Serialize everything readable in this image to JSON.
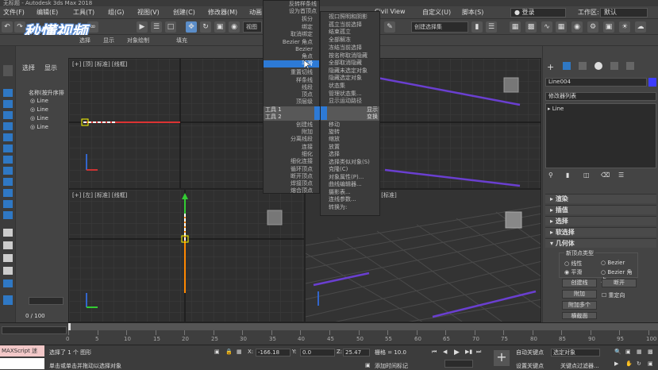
{
  "window": {
    "title": "无标题 - Autodesk 3ds Max 2018"
  },
  "menubar": {
    "items": [
      "文件(F)",
      "编辑(E)",
      "工具(T)",
      "组(G)",
      "视图(V)",
      "创建(C)",
      "修改器(M)",
      "动画",
      "Civil View",
      "自定义(U)",
      "脚本(S)"
    ],
    "login": "登录",
    "workspace_label": "工作区:",
    "workspace_value": "默认"
  },
  "toolbar": {
    "view_combo": "视图",
    "selection_set": "创建选择集"
  },
  "logo": {
    "text": "秒懂视频"
  },
  "ribbon": {
    "items": [
      "选择",
      "显示",
      "对象绘制",
      "填充"
    ]
  },
  "scene_explorer": {
    "tabs": [
      "选择",
      "显示"
    ],
    "header": "名称(按升序排",
    "items": [
      "Line",
      "Line",
      "Line",
      "Line"
    ]
  },
  "viewports": {
    "top": "[+] [顶] [标准] [线框]",
    "front": "[+] [前] [标准] [线框]",
    "left": "[+] [左] [标准] [线框]",
    "persp": "[+] [透视] [标准]"
  },
  "context_menu": {
    "quad1": [
      {
        "t": "反转样条线",
        "c": ""
      },
      {
        "t": "设为首顶点",
        "c": ""
      },
      {
        "t": "拆分",
        "c": ""
      },
      {
        "t": "绑定",
        "c": ""
      },
      {
        "t": "取消绑定",
        "c": ""
      },
      {
        "t": "Bezier 角点",
        "c": ""
      },
      {
        "t": "Bezier",
        "c": ""
      },
      {
        "t": "角点",
        "c": ""
      },
      {
        "t": "平滑",
        "c": "hl"
      },
      {
        "t": "重置切线",
        "c": ""
      },
      {
        "t": "样条线",
        "c": ""
      },
      {
        "t": "线段",
        "c": ""
      },
      {
        "t": "顶点",
        "c": ""
      },
      {
        "t": "顶层级",
        "c": ""
      }
    ],
    "tools1": "工具 1",
    "tools2": "工具 2",
    "quad1_lower": [
      {
        "t": "创建线",
        "c": ""
      },
      {
        "t": "附加",
        "c": ""
      },
      {
        "t": "分离线段",
        "c": ""
      },
      {
        "t": "连接",
        "c": ""
      },
      {
        "t": "细化",
        "c": ""
      },
      {
        "t": "细化连接",
        "c": ""
      },
      {
        "t": "循环顶点",
        "c": ""
      },
      {
        "t": "断开顶点",
        "c": ""
      },
      {
        "t": "焊接顶点",
        "c": ""
      },
      {
        "t": "熔合顶点",
        "c": ""
      }
    ],
    "quad2": [
      {
        "t": "视口照明和阴影",
        "c": ""
      },
      {
        "t": "孤立当前选择",
        "c": ""
      },
      {
        "t": "结束孤立",
        "c": ""
      },
      {
        "t": "全部解冻",
        "c": ""
      },
      {
        "t": "冻结当前选择",
        "c": ""
      },
      {
        "t": "按名称取消隐藏",
        "c": ""
      },
      {
        "t": "全部取消隐藏",
        "c": ""
      },
      {
        "t": "隐藏未选定对象",
        "c": ""
      },
      {
        "t": "隐藏选定对象",
        "c": ""
      },
      {
        "t": "状态集",
        "c": ""
      },
      {
        "t": "管理状态集...",
        "c": ""
      },
      {
        "t": "显示运动路径",
        "c": ""
      }
    ],
    "display": "显示",
    "transform": "变换",
    "quad2_lower": [
      {
        "t": "移动",
        "c": ""
      },
      {
        "t": "旋转",
        "c": ""
      },
      {
        "t": "缩放",
        "c": ""
      },
      {
        "t": "放置",
        "c": ""
      },
      {
        "t": "选择",
        "c": ""
      },
      {
        "t": "选择类似对象(S)",
        "c": ""
      },
      {
        "t": "克隆(C)",
        "c": ""
      },
      {
        "t": "对象属性(P)...",
        "c": ""
      },
      {
        "t": "曲线编辑器...",
        "c": ""
      },
      {
        "t": "摄影表...",
        "c": ""
      },
      {
        "t": "连线参数...",
        "c": ""
      },
      {
        "t": "转换为:",
        "c": ""
      }
    ]
  },
  "right_panel": {
    "object_name": "Line004",
    "modifier_list": "修改器列表",
    "stack_item": "Line",
    "sections": [
      "渲染",
      "插值",
      "选择",
      "软选择",
      "几何体"
    ],
    "new_vertex_type": "新顶点类型",
    "radio": [
      "线性",
      "Bezier",
      "平滑",
      "Bezier 角点"
    ],
    "buttons": {
      "create_line": "创建线",
      "break": "断开",
      "attach": "附加",
      "reorient": "重定向",
      "attach_mult": "附加多个",
      "cross_section": "横截面"
    }
  },
  "timeline": {
    "frame": "0 / 100",
    "ticks": [
      "0",
      "5",
      "10",
      "15",
      "20",
      "25",
      "30",
      "35",
      "40",
      "45",
      "50",
      "55",
      "60",
      "65",
      "70",
      "75",
      "80",
      "85",
      "90",
      "95",
      "100"
    ]
  },
  "status": {
    "script": "MAXScript 迷",
    "selected": "选择了 1 个 图形",
    "hint": "单击或单击并拖动以选择对象",
    "x_label": "X:",
    "x_value": "-166.18",
    "y_label": "Y:",
    "y_value": "0.0",
    "z_label": "Z:",
    "z_value": "25.47",
    "grid": "栅格 = 10.0",
    "add_time_tag": "添加时间标记",
    "auto_key": "自动关键点",
    "set_key": "设置关键点",
    "selected_obj": "选定对象",
    "key_filter": "关键点过滤器..."
  }
}
